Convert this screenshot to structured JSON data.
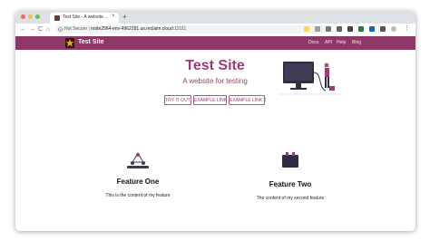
{
  "colors": {
    "accent": "#9b3d74",
    "navbar": "#8e3868",
    "traffic_red": "#ed6a5e",
    "traffic_yellow": "#f5bf4f",
    "traffic_green": "#61c554"
  },
  "browser": {
    "tab_title": "Test Site - A website for testing",
    "tab_close": "×",
    "new_tab": "+",
    "nav": {
      "back": "←",
      "forward": "→",
      "reload": "C",
      "home": "⌂"
    },
    "security_label": "Not Secure",
    "url_host": "node2564-env-4962181.us.reclaim.cloud",
    "url_port": ":11011"
  },
  "site": {
    "brand": "Test Site",
    "nav_links": [
      "Docs",
      "API",
      "Help",
      "Blog"
    ],
    "hero": {
      "title": "Test Site",
      "subtitle": "A website for testing",
      "buttons": [
        "TRY IT OUT",
        "EXAMPLE LINK",
        "EXAMPLE LINK 2"
      ]
    },
    "features": [
      {
        "title": "Feature One",
        "text": "This is the content of my feature"
      },
      {
        "title": "Feature Two",
        "text": "The content of my second feature"
      }
    ]
  }
}
